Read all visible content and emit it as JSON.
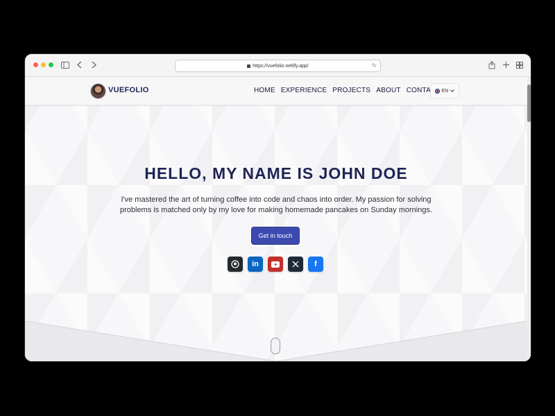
{
  "browser": {
    "url": "https://vuefolio.netlify.app/"
  },
  "navbar": {
    "brand": "VUEFOLIO",
    "links": [
      "HOME",
      "EXPERIENCE",
      "PROJECTS",
      "ABOUT",
      "CONTACT"
    ],
    "language": "EN"
  },
  "hero": {
    "title": "HELLO, MY NAME IS JOHN DOE",
    "text": "I've mastered the art of turning coffee into code and chaos into order. My passion for solving problems is matched only by my love for making homemade pancakes on Sunday mornings.",
    "cta_label": "Get in touch",
    "socials": [
      "github-icon",
      "linkedin-icon",
      "youtube-icon",
      "x-icon",
      "facebook-icon"
    ]
  },
  "colors": {
    "brand": "#1f2454",
    "cta": "#3c4ab0"
  }
}
